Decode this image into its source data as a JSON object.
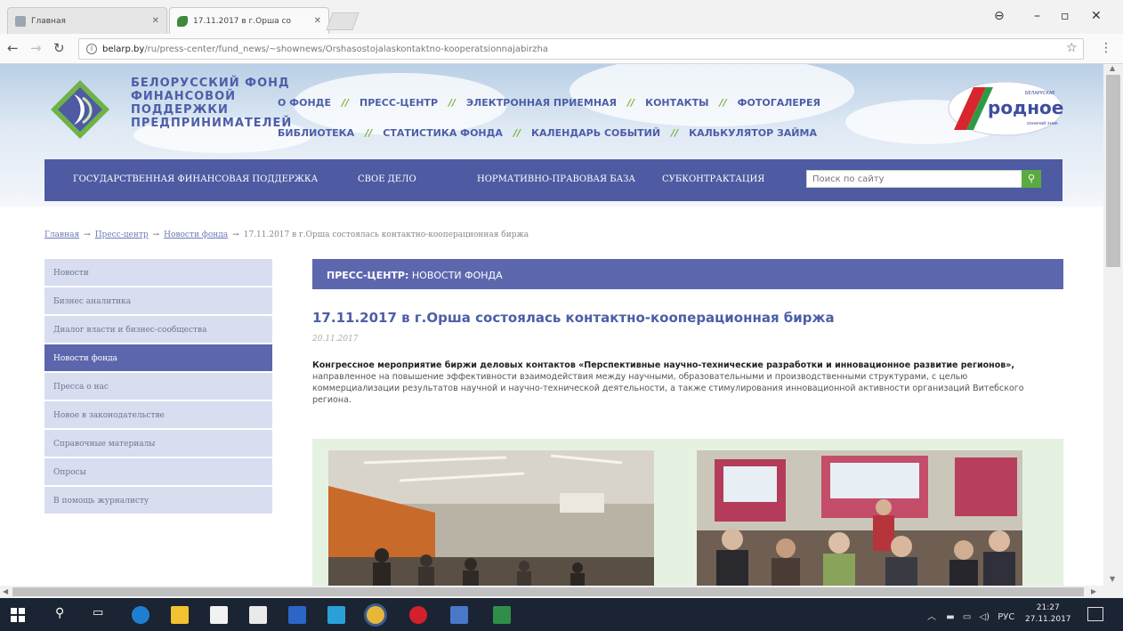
{
  "browser": {
    "tabs": [
      {
        "title": "Главная"
      },
      {
        "title": "17.11.2017 в г.Орша со"
      }
    ],
    "url": {
      "host": "belarp.by",
      "path": "/ru/press-center/fund_news/~shownews/Orshasostojalaskontaktno-kooperatsionnajabirzha"
    }
  },
  "header": {
    "logo_lines": [
      "БЕЛОРУССКИЙ ФОНД",
      "ФИНАНСОВОЙ",
      "ПОДДЕРЖКИ",
      "ПРЕДПРИНИМАТЕЛЕЙ"
    ],
    "topnav_row1": [
      "О ФОНДЕ",
      "ПРЕСС-ЦЕНТР",
      "ЭЛЕКТРОННАЯ ПРИЕМНАЯ",
      "КОНТАКТЫ",
      "ФОТОГАЛЕРЕЯ"
    ],
    "topnav_row2": [
      "БИБЛИОТЕКА",
      "СТАТИСТИКА ФОНДА",
      "КАЛЕНДАРЬ СОБЫТИЙ",
      "КАЛЬКУЛЯТОР ЗАЙМА"
    ],
    "separator": "//",
    "brand_logo": {
      "word": "родное",
      "tag_top": "БЕЛАРУСКАЕ",
      "tag_bottom": "означай знак"
    }
  },
  "mainnav": {
    "items": [
      "ГОСУДАРСТВЕННАЯ ФИНАНСОВАЯ ПОДДЕРЖКА",
      "СВОЕ ДЕЛО",
      "НОРМАТИВНО-ПРАВОВАЯ БАЗА",
      "СУБКОНТРАКТАЦИЯ"
    ],
    "search_placeholder": "Поиск по сайту"
  },
  "breadcrumb": {
    "links": [
      "Главная",
      "Пресс-центр",
      "Новости фонда"
    ],
    "current": "17.11.2017 в г.Орша состоялась контактно-кооперационная биржа",
    "arrow": "→"
  },
  "sidebar": {
    "items": [
      "Новости",
      "Бизнес аналитика",
      "Диалог власти и бизнес-сообщества",
      "Новости фонда",
      "Пресса о нас",
      "Новое в законодательстве",
      "Справочные материалы",
      "Опросы",
      "В помощь журналисту"
    ],
    "active_index": 3
  },
  "article": {
    "section_bold": "ПРЕСС-ЦЕНТР:",
    "section_rest": " НОВОСТИ ФОНДА",
    "title": "17.11.2017 в г.Орша состоялась контактно-кооперационная биржа",
    "date": "20.11.2017",
    "body_bold": "Конгрессное мероприятие биржи деловых контактов «Перспективные научно-технические разработки и инновационное развитие регионов»,",
    "body_rest": " направленное на повышение эффективности взаимодействия между научными, образовательными и производственными структурами, с целью коммерциализации результатов научной и научно-технической деятельности, а также стимулирования инновационной активности организаций Витебского региона."
  },
  "taskbar": {
    "tray_lang": "РУС",
    "time": "21:27",
    "date": "27.11.2017"
  },
  "colors": {
    "brand_blue": "#4e5ba2",
    "brand_green": "#79b13a",
    "sidebar_bg": "#d8def0",
    "sidebar_active": "#5b66ac"
  }
}
